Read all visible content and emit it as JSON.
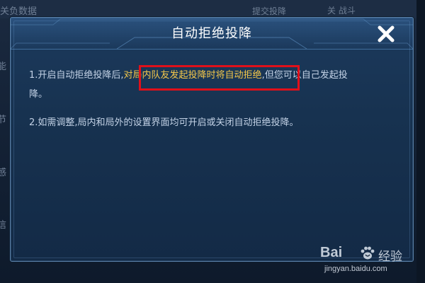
{
  "background": {
    "top_left_text": "关负数据",
    "top_right_text": "提交投降",
    "top_right_text_2": "关  战斗",
    "side_labels": [
      "能",
      "节",
      "感",
      "信"
    ]
  },
  "dialog": {
    "title": "自动拒绝投降",
    "close_icon": "close-icon",
    "paragraph1": {
      "prefix": "1.开启自动拒绝投降后,",
      "highlight": "对局内队友发起投降时将自动拒绝",
      "suffix": ",但您可以自己发起投",
      "continuation": "降。"
    },
    "paragraph2": "2.如需调整,局内和局外的设置界面均可开启或关闭自动拒绝投降。"
  },
  "watermark": {
    "brand_latin": "Bai",
    "brand_cn": "经验",
    "url": "jingyan.baidu.com"
  },
  "colors": {
    "highlight_text": "#f3c74a",
    "annotation_border": "#e0101a",
    "body_text": "#c3d2e6",
    "title_text": "#ffffff"
  }
}
